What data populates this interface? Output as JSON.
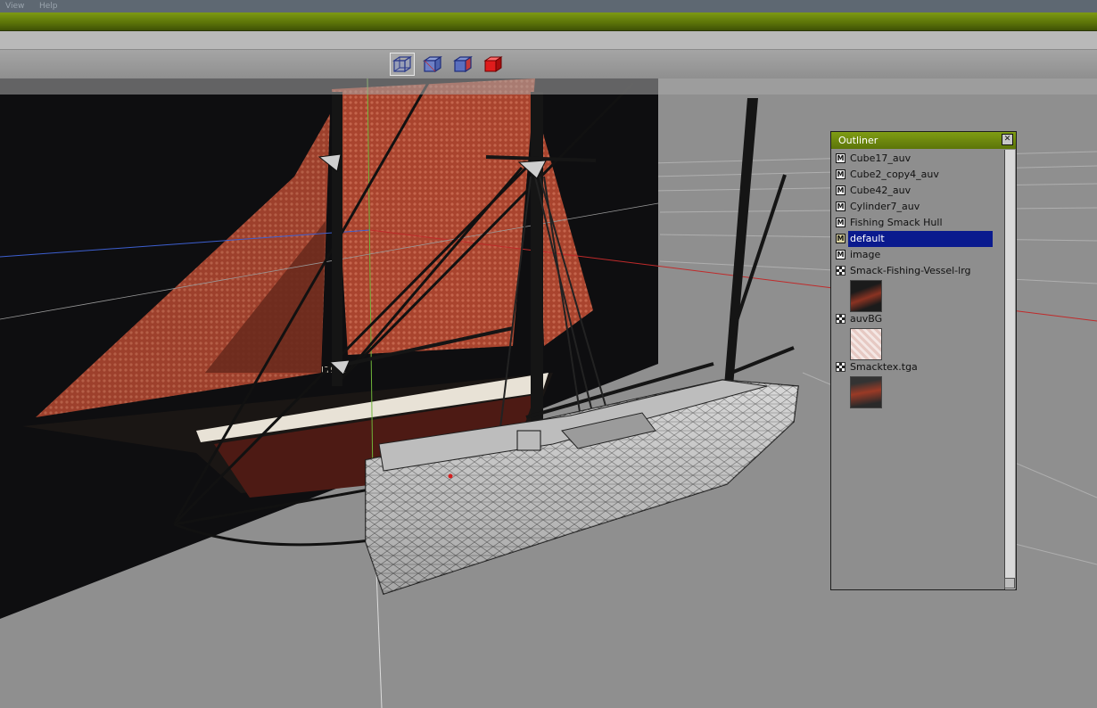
{
  "menu": [
    "View",
    "Help"
  ],
  "view_buttons": [
    {
      "name": "wireframe-cube-view",
      "color": "#7f92c6"
    },
    {
      "name": "shaded-wire-cube-view",
      "color": "#6b7fc2"
    },
    {
      "name": "textured-cube-view",
      "color": "#5f76bd"
    },
    {
      "name": "solid-red-cube-view",
      "color": "#d22020"
    }
  ],
  "outliner": {
    "title": "Outliner",
    "close_glyph": "✕",
    "items": [
      {
        "label": "Cube17_auv",
        "kind": "M"
      },
      {
        "label": "Cube2_copy4_auv",
        "kind": "M"
      },
      {
        "label": "Cube42_auv",
        "kind": "M"
      },
      {
        "label": "Cylinder7_auv",
        "kind": "M"
      },
      {
        "label": "Fishing Smack Hull",
        "kind": "M"
      },
      {
        "label": "default",
        "kind": "M",
        "selected": true
      },
      {
        "label": "image",
        "kind": "M"
      }
    ],
    "textures": [
      {
        "label": "Smack-Fishing-Vessel-lrg"
      },
      {
        "label": "auvBG"
      },
      {
        "label": "Smacktex.tga"
      }
    ]
  },
  "scene": {
    "hull_text": "LT971"
  }
}
